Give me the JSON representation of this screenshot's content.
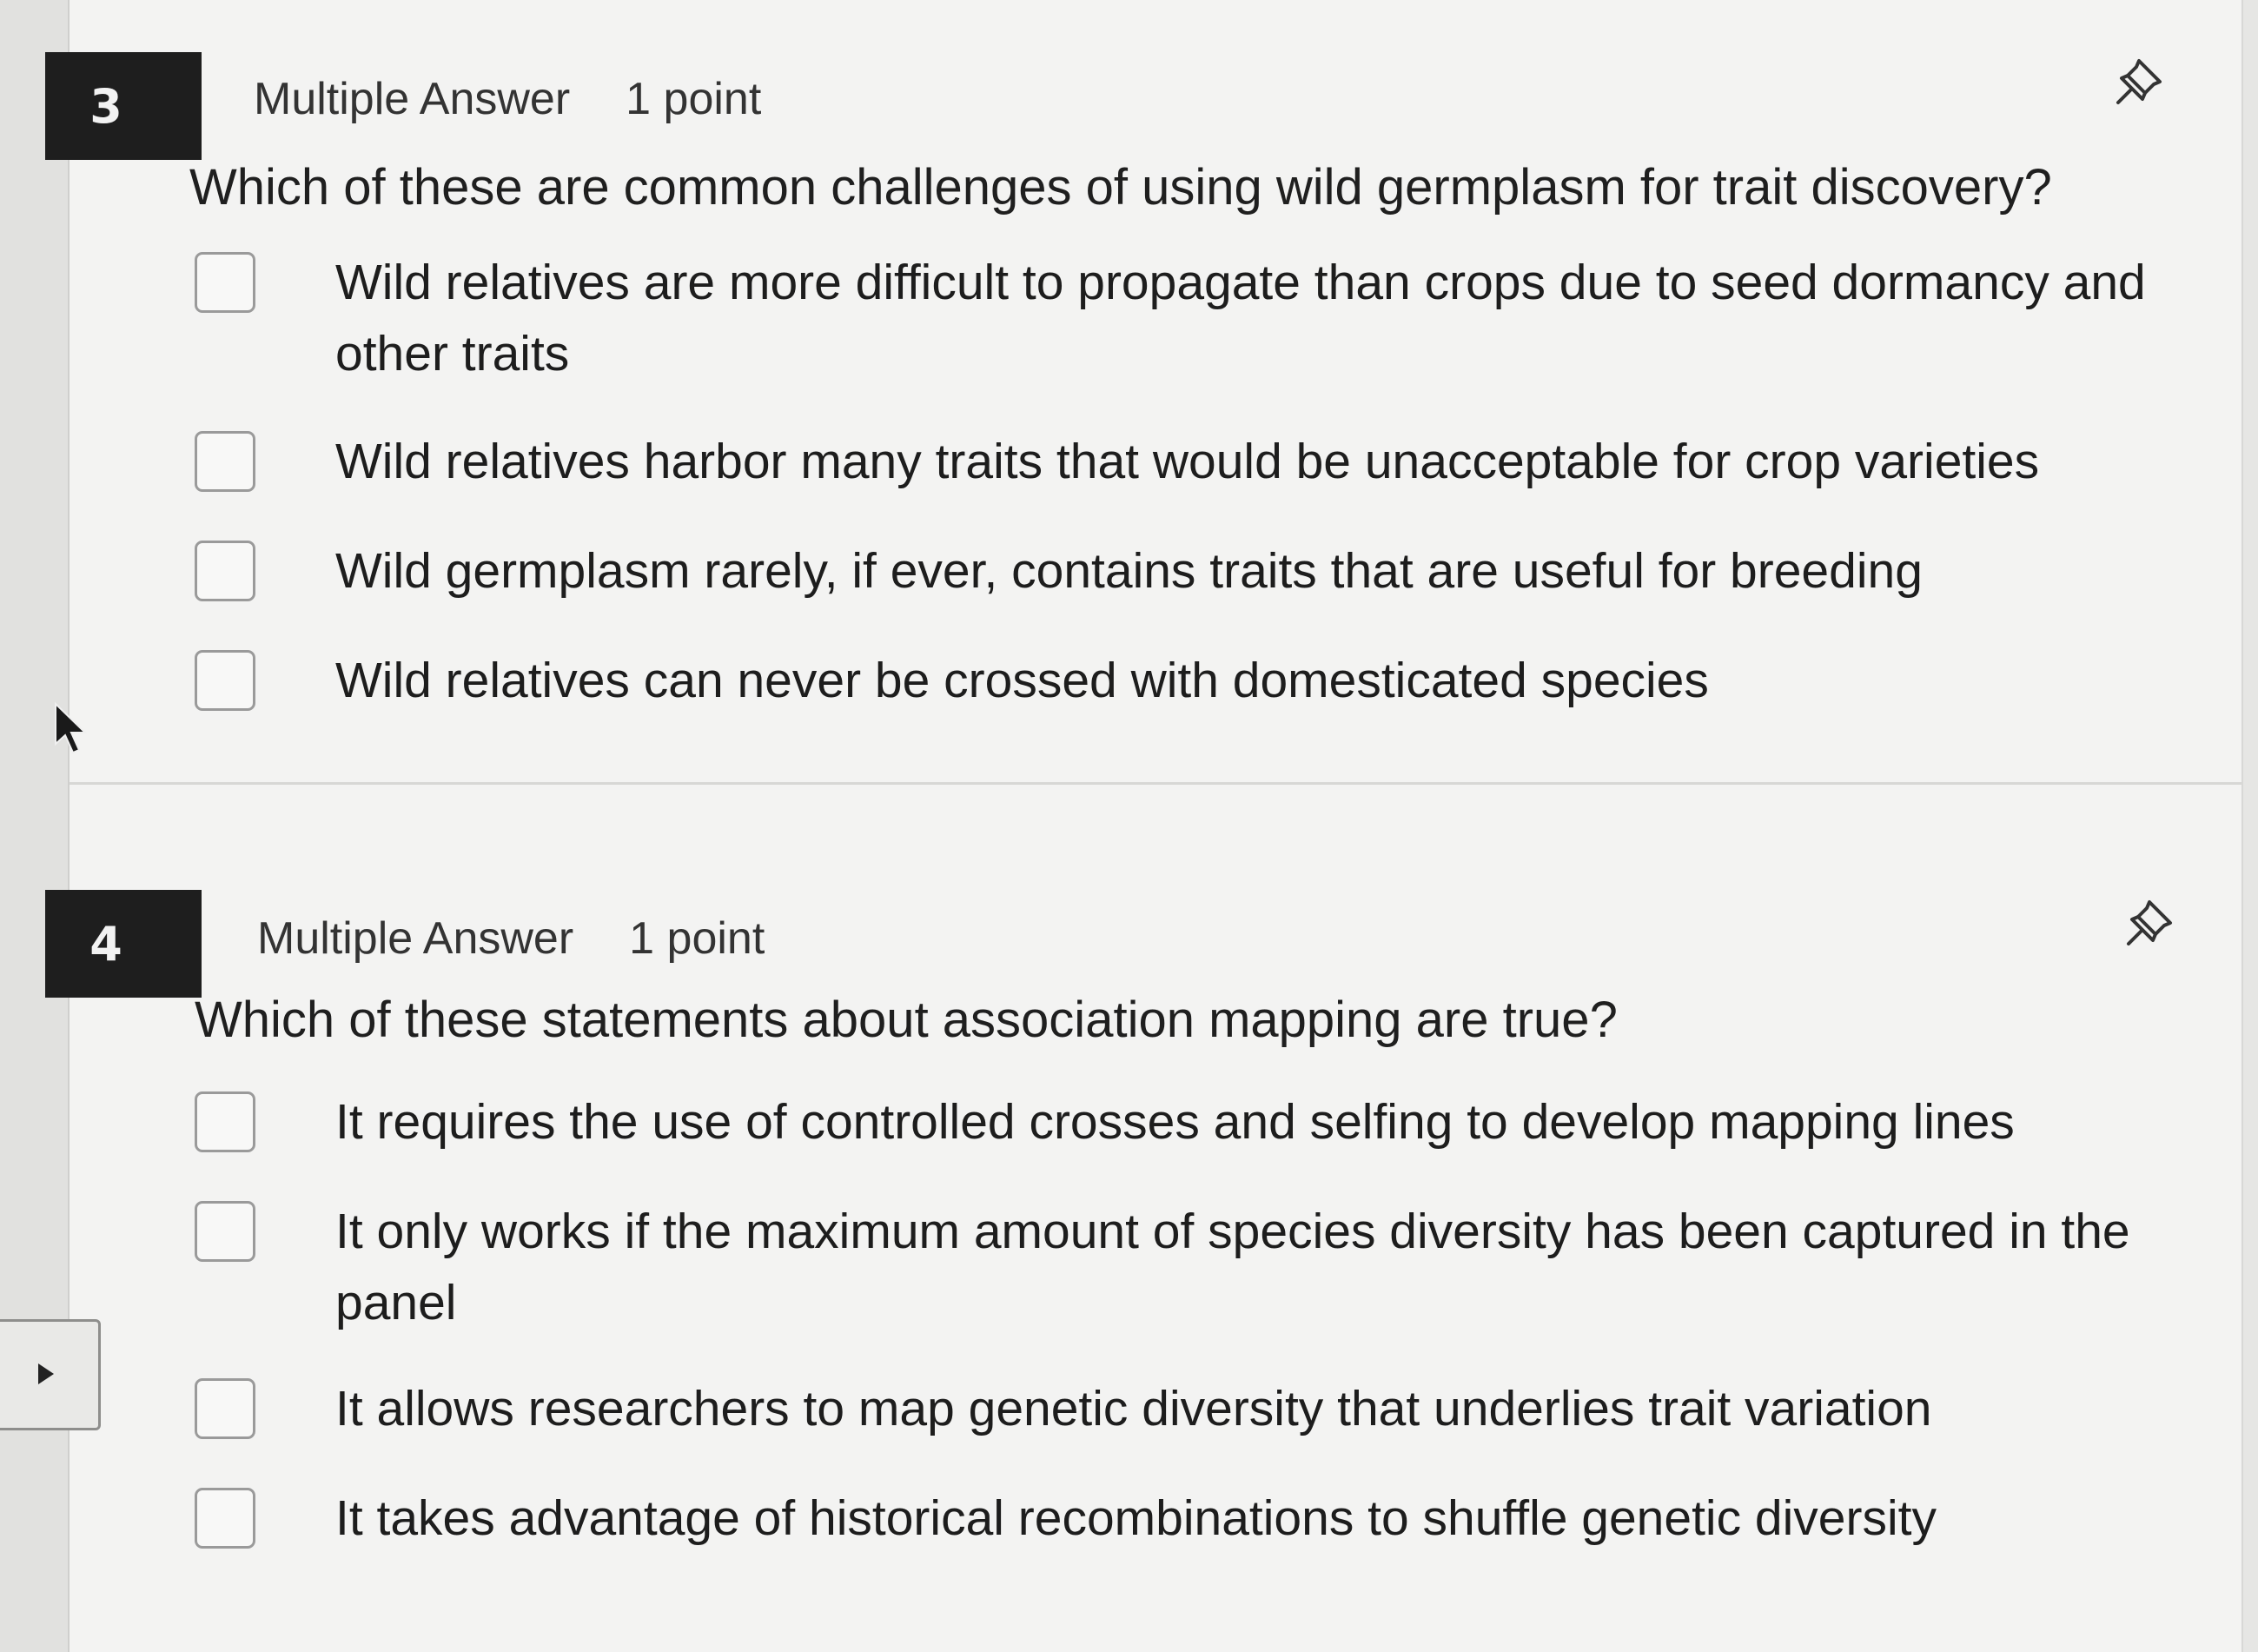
{
  "questions": [
    {
      "number": "3",
      "type": "Multiple Answer",
      "points": "1 point",
      "prompt": "Which of these are common challenges of using wild germplasm for trait discovery?",
      "options": [
        "Wild relatives are more difficult to propagate than crops due to seed dormancy and other traits",
        "Wild relatives harbor many traits that would be unacceptable for crop varieties",
        "Wild germplasm rarely, if ever, contains traits that are useful for breeding",
        "Wild relatives can never be crossed with domesticated species"
      ]
    },
    {
      "number": "4",
      "type": "Multiple Answer",
      "points": "1 point",
      "prompt": "Which of these statements about association mapping are true?",
      "options": [
        "It requires the use of controlled crosses and selfing to develop mapping lines",
        "It only works if the maximum amount of species diversity has been captured in the panel",
        "It allows researchers to map genetic diversity that underlies trait variation",
        "It takes advantage of historical recombinations to shuffle genetic diversity"
      ]
    }
  ],
  "icons": {
    "pin": "pin-icon",
    "cursor": "mouse-cursor-icon",
    "expand": "expand-arrow-icon"
  }
}
